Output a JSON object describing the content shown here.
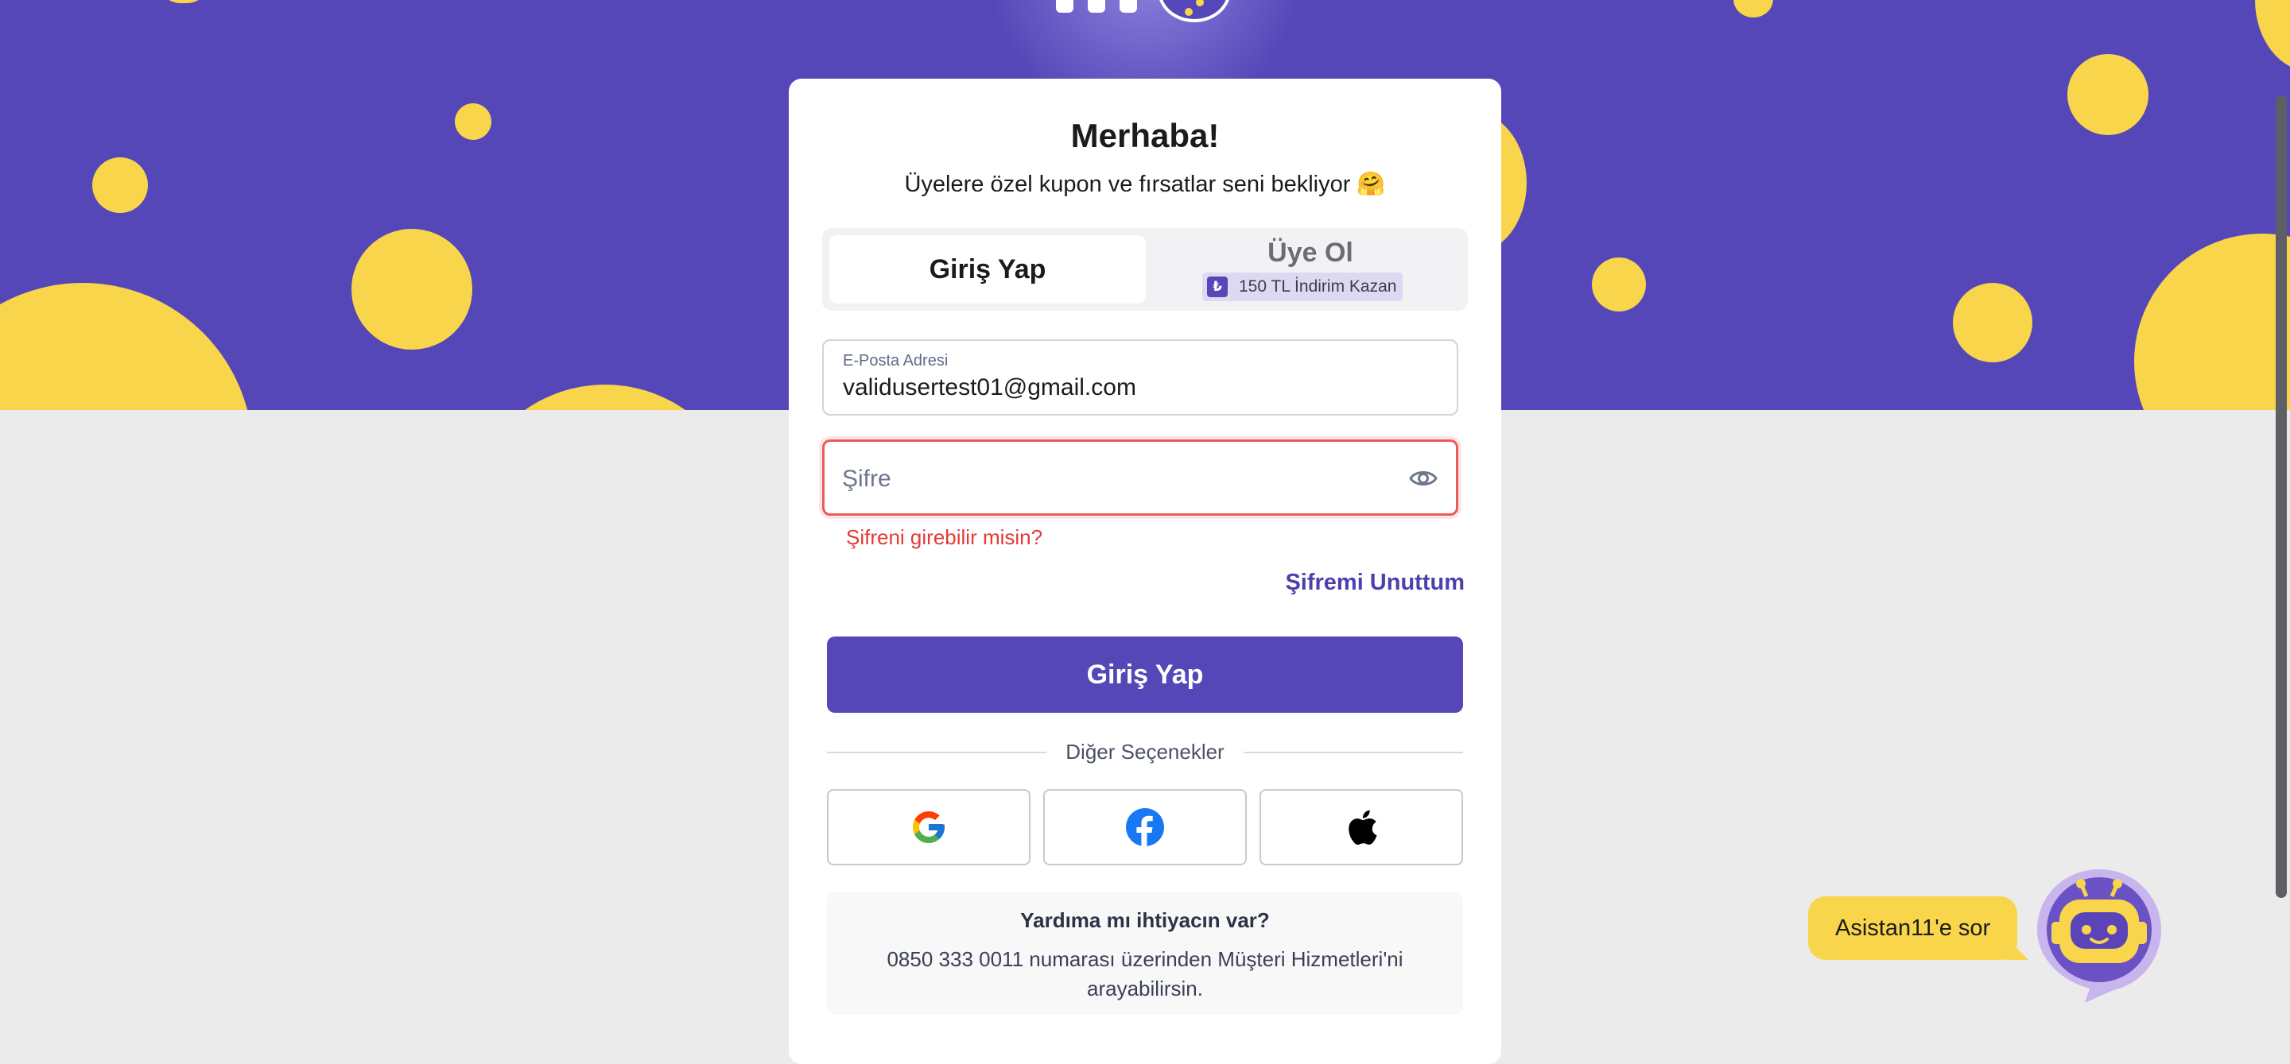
{
  "card": {
    "title": "Merhaba!",
    "subtitle": "Üyelere özel kupon ve fırsatlar seni bekliyor 🤗"
  },
  "tabs": {
    "login": "Giriş Yap",
    "register": "Üye Ol",
    "promo_icon": "₺",
    "promo": "150 TL İndirim Kazan"
  },
  "form": {
    "email_label": "E-Posta Adresi",
    "email_value": "validusertest01@gmail.com",
    "password_placeholder": "Şifre",
    "password_error": "Şifreni girebilir misin?",
    "forgot": "Şifremi Unuttum",
    "submit": "Giriş Yap"
  },
  "other_options": "Diğer Seçenekler",
  "social": {
    "google": "google-icon",
    "facebook": "facebook-icon",
    "apple": "apple-icon"
  },
  "help": {
    "title": "Yardıma mı ihtiyacın var?",
    "body": "0850 333 0011 numarası üzerinden Müşteri Hizmetleri'ni arayabilirsin."
  },
  "assistant": {
    "label": "Asistan11'e sor"
  },
  "colors": {
    "brand_purple": "#5647b8",
    "accent_yellow": "#f8d54b",
    "error_red": "#e53935"
  }
}
